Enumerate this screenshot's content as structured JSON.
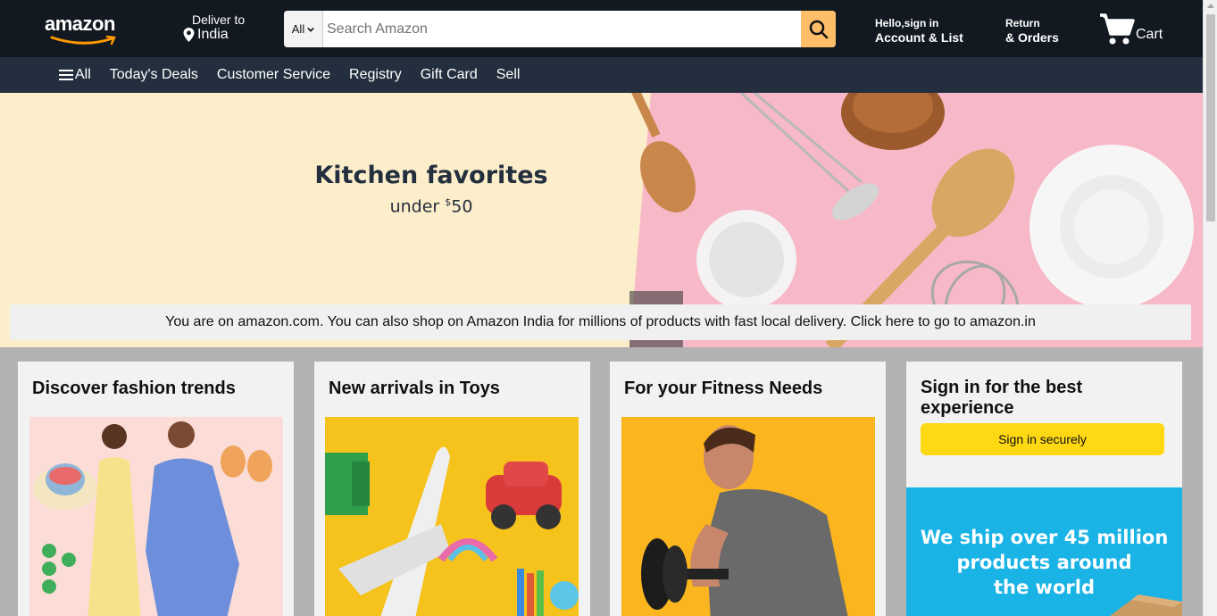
{
  "header": {
    "logo_text": "amazon",
    "deliver_label": "Deliver to",
    "deliver_location": "India",
    "search": {
      "category": "All",
      "placeholder": "Search Amazon"
    },
    "account_line1": "Hello,sign in",
    "account_line2": "Account & List",
    "orders_line1": "Return",
    "orders_line2": "& Orders",
    "cart_label": "Cart"
  },
  "subnav": {
    "all_label": "All",
    "items": [
      "Today's Deals",
      "Customer Service",
      "Registry",
      "Gift Card",
      "Sell"
    ]
  },
  "hero": {
    "title": "Kitchen favorites",
    "subtitle_prefix": "under ",
    "subtitle_currency": "$",
    "subtitle_amount": "50",
    "notice": "You are on amazon.com. You can also shop on Amazon India for millions of products with fast local delivery. Click here to go to amazon.in"
  },
  "cards": [
    {
      "title": "Discover fashion trends"
    },
    {
      "title": "New arrivals in Toys"
    },
    {
      "title": "For your Fitness Needs"
    }
  ],
  "signin_card": {
    "title": "Sign in for the best experience",
    "button_label": "Sign in securely",
    "ship_line1": "We ship over 45 million",
    "ship_line2": "products around",
    "ship_line3": "the world"
  },
  "colors": {
    "topnav_bg": "#131921",
    "subnav_bg": "#232f3e",
    "search_button": "#febd69",
    "signin_button": "#ffd814",
    "hero_bg": "#fdeecb",
    "hero_pink": "#f7b8c8",
    "ship_banner": "#1ab3e6"
  },
  "icons": {
    "location": "pin-icon",
    "search": "search-icon",
    "cart": "cart-icon",
    "menu": "hamburger-menu-icon"
  }
}
